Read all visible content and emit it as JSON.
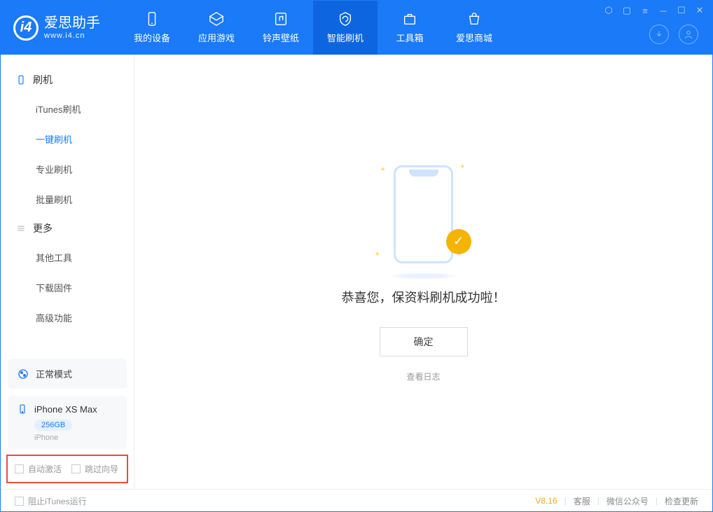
{
  "app": {
    "title": "爱思助手",
    "subtitle": "www.i4.cn"
  },
  "nav": {
    "tabs": [
      {
        "label": "我的设备"
      },
      {
        "label": "应用游戏"
      },
      {
        "label": "铃声壁纸"
      },
      {
        "label": "智能刷机"
      },
      {
        "label": "工具箱"
      },
      {
        "label": "爱思商城"
      }
    ]
  },
  "sidebar": {
    "section1_title": "刷机",
    "section1_items": [
      {
        "label": "iTunes刷机"
      },
      {
        "label": "一键刷机"
      },
      {
        "label": "专业刷机"
      },
      {
        "label": "批量刷机"
      }
    ],
    "section2_title": "更多",
    "section2_items": [
      {
        "label": "其他工具"
      },
      {
        "label": "下载固件"
      },
      {
        "label": "高级功能"
      }
    ],
    "mode_label": "正常模式",
    "device": {
      "name": "iPhone XS Max",
      "storage": "256GB",
      "type": "iPhone"
    },
    "checkboxes": {
      "auto_activate": "自动激活",
      "skip_guide": "跳过向导"
    }
  },
  "main": {
    "success_message": "恭喜您，保资料刷机成功啦！",
    "ok_button": "确定",
    "view_log": "查看日志"
  },
  "footer": {
    "block_itunes": "阻止iTunes运行",
    "version": "V8.16",
    "links": {
      "support": "客服",
      "wechat": "微信公众号",
      "update": "检查更新"
    }
  }
}
